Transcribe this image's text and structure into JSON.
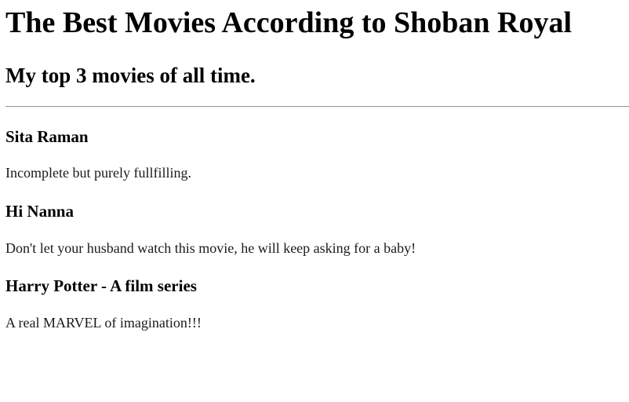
{
  "header": {
    "title": "The Best Movies According to Shoban Royal",
    "subtitle": "My top 3 movies of all time."
  },
  "movies": [
    {
      "title": "Sita Raman",
      "description": "Incomplete but purely fullfilling."
    },
    {
      "title": "Hi Nanna",
      "description": "Don't let your husband watch this movie, he will keep asking for a baby!"
    },
    {
      "title": "Harry Potter - A film series",
      "description": "A real MARVEL of imagination!!!"
    }
  ]
}
